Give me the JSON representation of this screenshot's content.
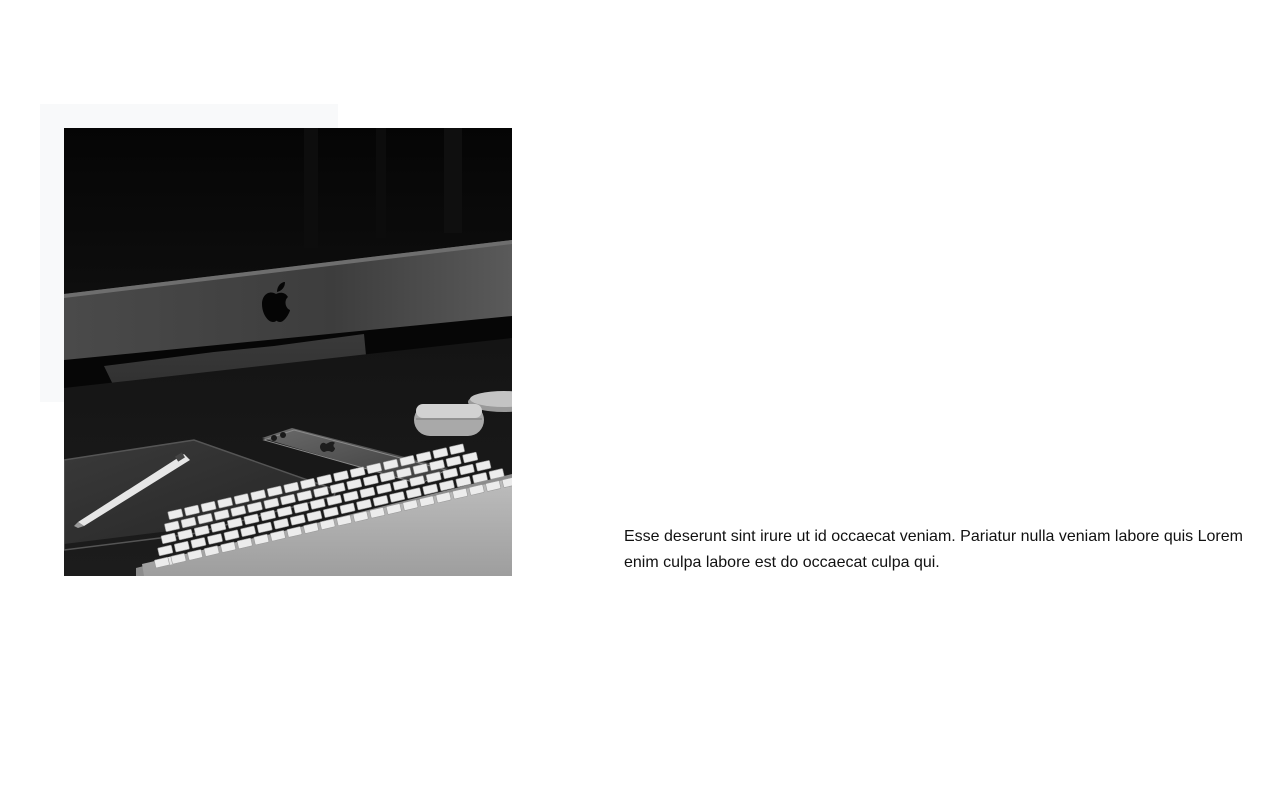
{
  "hero_section": {
    "image": {
      "icon": "workspace-photo",
      "description_colors": {
        "panel": "#f8f9fa",
        "photo_dark": "#0a0a0a"
      }
    },
    "body_text": "Esse deserunt sint irure ut id occaecat veniam. Pariatur nulla veniam labore quis Lorem enim culpa labore est do occaecat culpa qui."
  }
}
